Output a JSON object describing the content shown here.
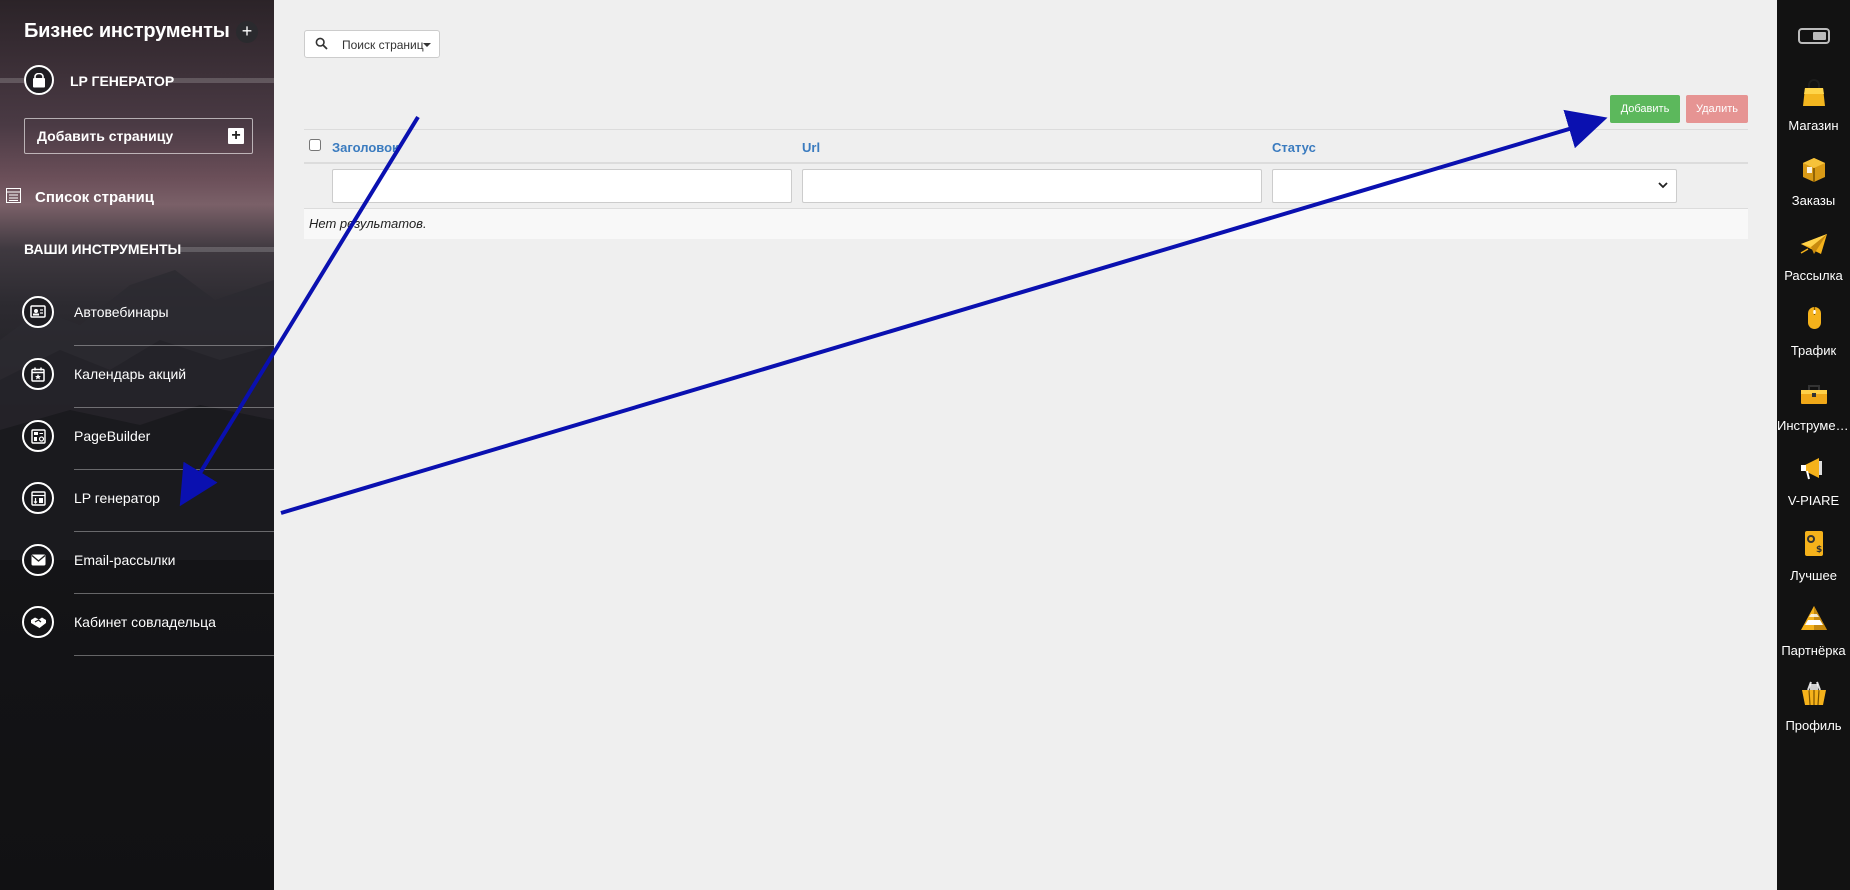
{
  "sidebar": {
    "title": "Бизнес инструменты",
    "plus_symbol": "+",
    "lp_section_label": "LP ГЕНЕРАТОР",
    "lp_section_icon": "shopping-bag-icon",
    "add_page_label": "Добавить страницу",
    "add_page_plus": "+",
    "pages_list_label": "Список страниц",
    "tools_header": "ВАШИ ИНСТРУМЕНТЫ",
    "tools": [
      {
        "label": "Автовебинары",
        "icon": "webinar-icon"
      },
      {
        "label": "Календарь акций",
        "icon": "calendar-icon"
      },
      {
        "label": "PageBuilder",
        "icon": "page-builder-icon"
      },
      {
        "label": "LP генератор",
        "icon": "lp-generator-icon"
      },
      {
        "label": "Email-рассылки",
        "icon": "envelope-icon"
      },
      {
        "label": "Кабинет совладельца",
        "icon": "handshake-icon"
      }
    ]
  },
  "main": {
    "search_dropdown_label": "Поиск страниц",
    "add_button": "Добавить",
    "delete_button": "Удалить",
    "table": {
      "columns": [
        "Заголовок",
        "Url",
        "Статус"
      ],
      "empty_text": "Нет результатов."
    },
    "colors": {
      "add": "#5cb85c",
      "delete": "#e69493",
      "header_link": "#3a7bbf",
      "annotation_arrow": "#0a10b0"
    }
  },
  "rightbar": {
    "items": [
      {
        "label": "Магазин",
        "icon": "shopping-bag-icon"
      },
      {
        "label": "Заказы",
        "icon": "package-icon"
      },
      {
        "label": "Рассылка",
        "icon": "paper-plane-icon"
      },
      {
        "label": "Трафик",
        "icon": "mouse-icon"
      },
      {
        "label": "Инструменты",
        "icon": "toolbox-icon"
      },
      {
        "label": "V-PIARE",
        "icon": "megaphone-icon"
      },
      {
        "label": "Лучшее",
        "icon": "best-badge-icon"
      },
      {
        "label": "Партнёрка",
        "icon": "pyramid-icon"
      },
      {
        "label": "Профиль",
        "icon": "basket-icon"
      }
    ]
  }
}
